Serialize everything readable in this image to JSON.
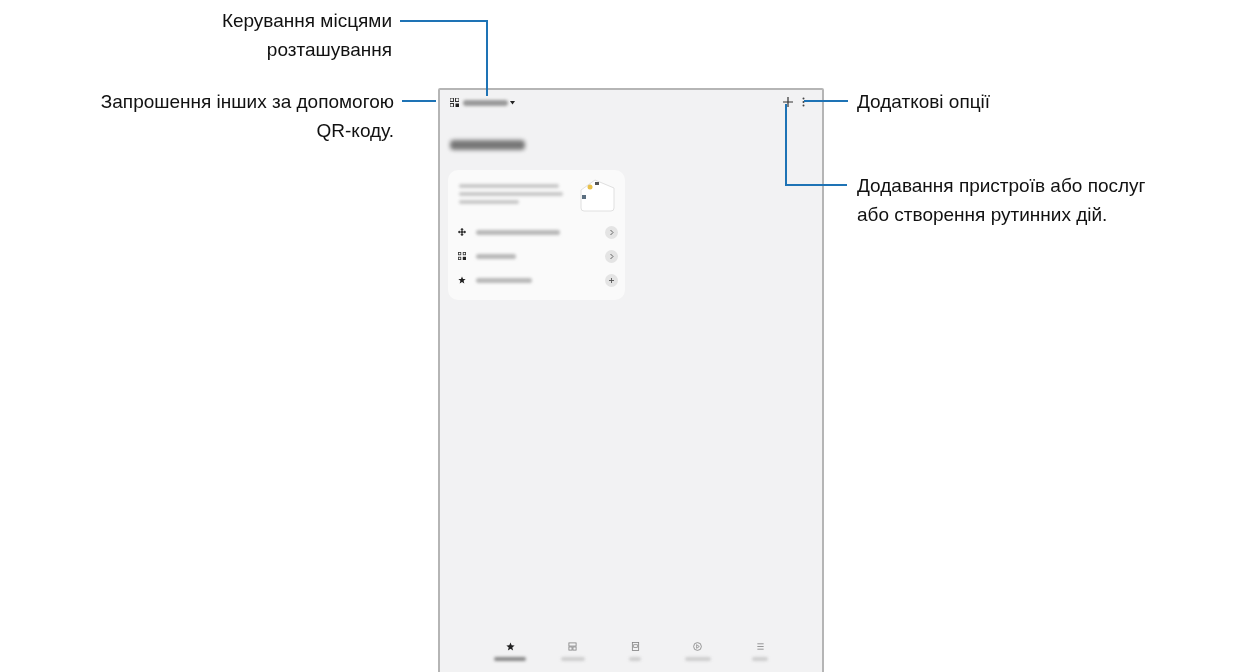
{
  "callouts": [
    {
      "kind": "left",
      "lines": [
        "Керування місцями",
        "розташування"
      ]
    },
    {
      "kind": "left",
      "lines": [
        "Запрошення інших за допомогою",
        "QR-коду."
      ]
    },
    {
      "kind": "right",
      "lines": [
        "Додаткові опції"
      ]
    },
    {
      "kind": "right",
      "lines": [
        "Додавання пристроїв або послуг",
        "або створення рутинних дій."
      ]
    }
  ],
  "card_rows": [
    {
      "kind": "link"
    },
    {
      "kind": "link"
    },
    {
      "kind": "add"
    }
  ],
  "tabs": [
    {
      "selected": true
    },
    {
      "selected": false
    },
    {
      "selected": false
    },
    {
      "selected": false
    },
    {
      "selected": false
    }
  ]
}
